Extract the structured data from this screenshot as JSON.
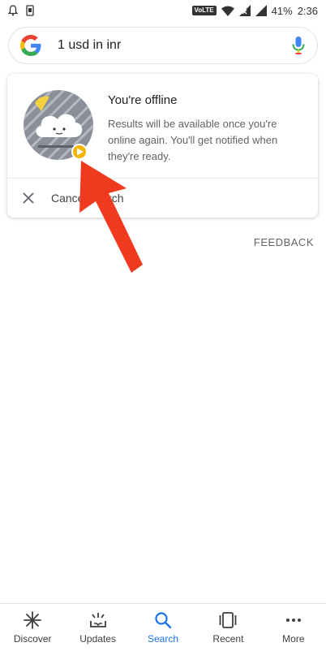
{
  "status_bar": {
    "volte": "VoLTE",
    "battery_percent": "41%",
    "time": "2:36"
  },
  "search": {
    "query": "1 usd in inr"
  },
  "offline_card": {
    "title": "You're offline",
    "body": "Results will be available once you're online again. You'll get notified when they're ready.",
    "cancel_label": "Cancel search"
  },
  "feedback_label": "FEEDBACK",
  "bottom_nav": {
    "items": [
      {
        "label": "Discover",
        "icon": "discover-icon"
      },
      {
        "label": "Updates",
        "icon": "updates-icon"
      },
      {
        "label": "Search",
        "icon": "search-icon"
      },
      {
        "label": "Recent",
        "icon": "recent-icon"
      },
      {
        "label": "More",
        "icon": "more-icon"
      }
    ],
    "active_index": 2
  },
  "colors": {
    "accent": "#1a73e8",
    "arrow": "#f03a1f",
    "play_badge": "#f4b400"
  }
}
